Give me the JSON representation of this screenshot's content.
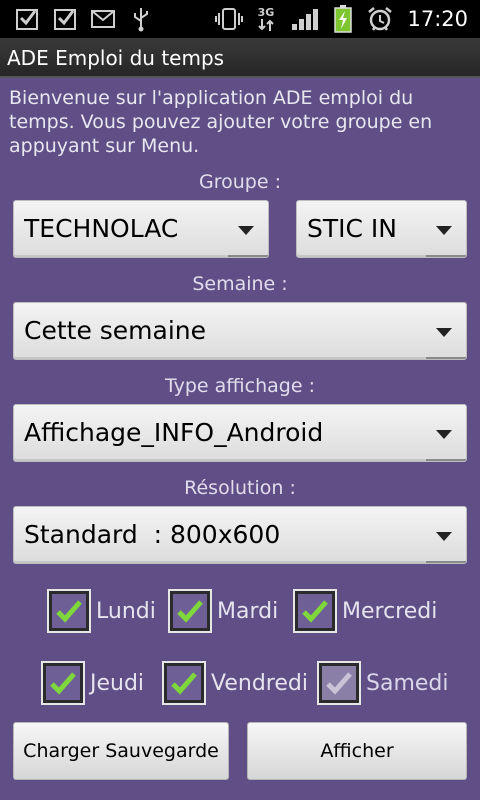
{
  "status_bar": {
    "time": "17:20",
    "network_label": "3G",
    "icons": [
      "checkbox-notification-icon",
      "checkbox-notification-icon",
      "mail-icon",
      "usb-icon",
      "vibrate-icon",
      "data-transfer-icon",
      "signal-icon",
      "battery-charging-icon",
      "alarm-icon"
    ],
    "colors": {
      "background": "#000000",
      "battery": "#7ec62f"
    }
  },
  "header": {
    "title": "ADE Emploi du temps"
  },
  "intro_text": "Bienvenue sur l'application ADE emploi du temps. Vous pouvez ajouter votre groupe en appuyant sur Menu.",
  "groupe": {
    "label": "Groupe :",
    "spinner1_value": "TECHNOLAC",
    "spinner2_value": "STIC IN"
  },
  "semaine": {
    "label": "Semaine :",
    "value": "Cette semaine"
  },
  "type_affichage": {
    "label": "Type affichage :",
    "value": "Affichage_INFO_Android"
  },
  "resolution": {
    "label": "Résolution :",
    "value": "Standard  : 800x600"
  },
  "days": [
    {
      "label": "Lundi",
      "checked": true
    },
    {
      "label": "Mardi",
      "checked": true
    },
    {
      "label": "Mercredi",
      "checked": true
    },
    {
      "label": "Jeudi",
      "checked": true
    },
    {
      "label": "Vendredi",
      "checked": true
    },
    {
      "label": "Samedi",
      "checked": true,
      "disabled": true
    }
  ],
  "buttons": {
    "load": "Charger Sauvegarde",
    "show": "Afficher"
  },
  "colors": {
    "background": "#5f4f86",
    "check": "#7fd83b"
  }
}
